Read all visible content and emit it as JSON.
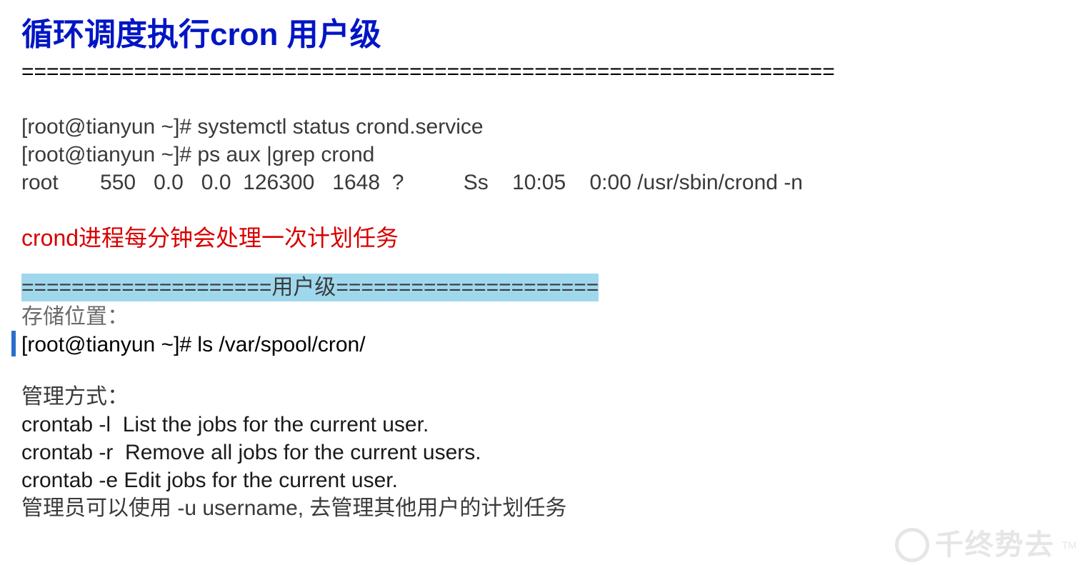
{
  "title": "循环调度执行cron  用户级",
  "separator_top": "=================================================================",
  "commands": {
    "line1": "[root@tianyun ~]# systemctl status crond.service",
    "line2": "[root@tianyun ~]# ps aux |grep crond",
    "line3": "root       550   0.0   0.0  126300   1648  ?          Ss    10:05    0:00 /usr/sbin/crond -n"
  },
  "red_note": "crond进程每分钟会处理一次计划任务",
  "highlighted_separator": "====================用户级=====================",
  "storage_label": "存储位置：",
  "storage_cmd": "[root@tianyun ~]# ls /var/spool/cron/",
  "mgmt_label": "管理方式：",
  "mgmt_lines": {
    "l1": "crontab -l  List the jobs for the current user.",
    "l2": "crontab -r  Remove all jobs for the current users.",
    "l3": "crontab -e Edit jobs for the current user."
  },
  "admin_note": "管理员可以使用 -u username, 去管理其他用户的计划任务",
  "watermark": "千终势去",
  "watermark_tm": "TM"
}
